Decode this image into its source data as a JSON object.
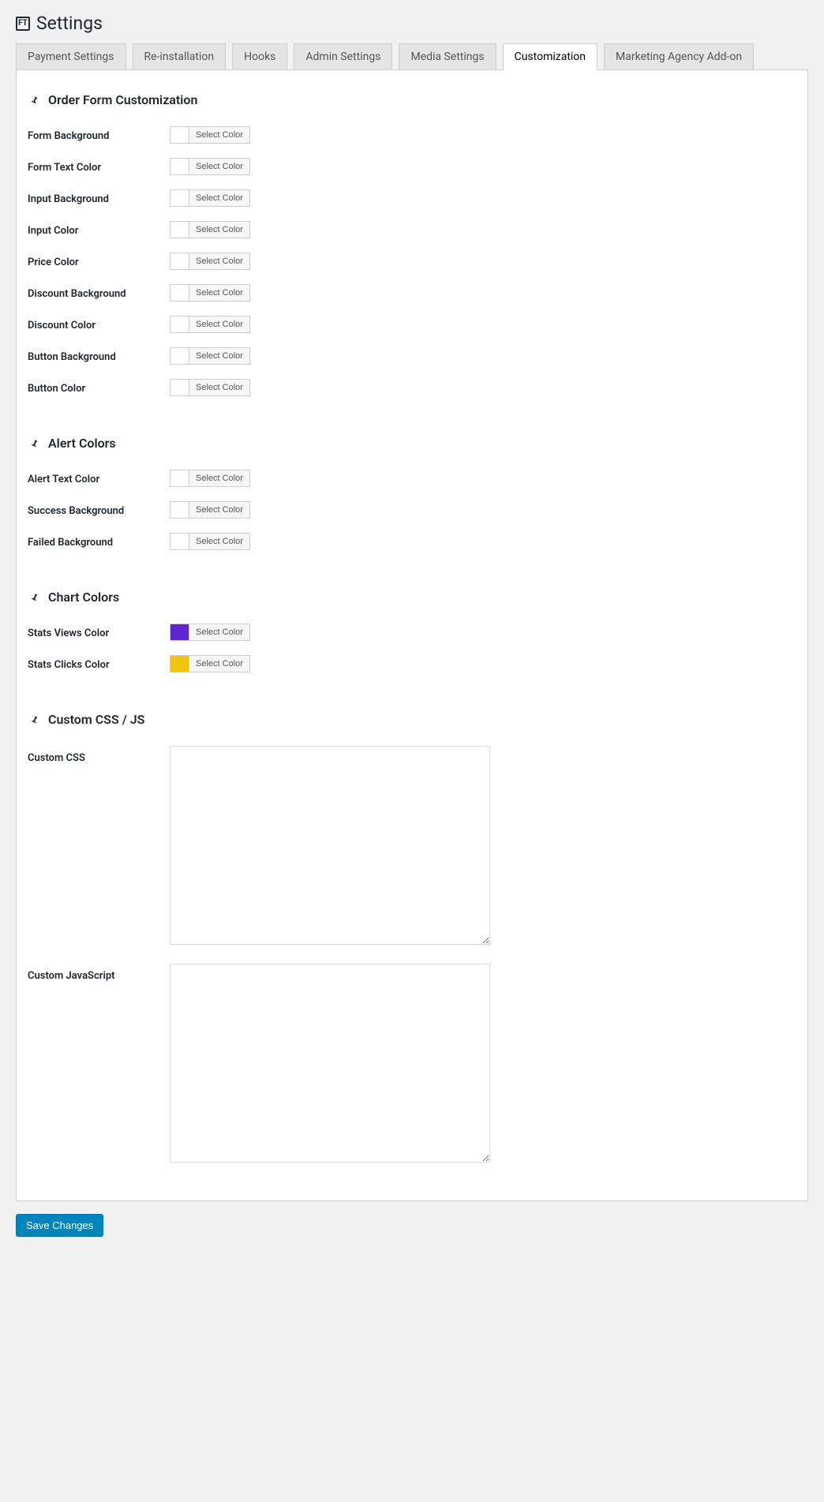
{
  "page": {
    "title": "Settings",
    "appIconText": "FT"
  },
  "tabs": [
    {
      "id": "payment",
      "label": "Payment Settings",
      "active": false
    },
    {
      "id": "reinstall",
      "label": "Re-installation",
      "active": false
    },
    {
      "id": "hooks",
      "label": "Hooks",
      "active": false
    },
    {
      "id": "admin",
      "label": "Admin Settings",
      "active": false
    },
    {
      "id": "media",
      "label": "Media Settings",
      "active": false
    },
    {
      "id": "custom",
      "label": "Customization",
      "active": true
    },
    {
      "id": "agency",
      "label": "Marketing Agency Add-on",
      "active": false
    }
  ],
  "sections": {
    "orderForm": {
      "title": "Order Form Customization",
      "rows": [
        {
          "name": "form-background",
          "label": "Form Background",
          "selectLabel": "Select Color",
          "value": ""
        },
        {
          "name": "form-text-color",
          "label": "Form Text Color",
          "selectLabel": "Select Color",
          "value": ""
        },
        {
          "name": "input-background",
          "label": "Input Background",
          "selectLabel": "Select Color",
          "value": ""
        },
        {
          "name": "input-color",
          "label": "Input Color",
          "selectLabel": "Select Color",
          "value": ""
        },
        {
          "name": "price-color",
          "label": "Price Color",
          "selectLabel": "Select Color",
          "value": ""
        },
        {
          "name": "discount-background",
          "label": "Discount Background",
          "selectLabel": "Select Color",
          "value": ""
        },
        {
          "name": "discount-color",
          "label": "Discount Color",
          "selectLabel": "Select Color",
          "value": ""
        },
        {
          "name": "button-background",
          "label": "Button Background",
          "selectLabel": "Select Color",
          "value": ""
        },
        {
          "name": "button-color",
          "label": "Button Color",
          "selectLabel": "Select Color",
          "value": ""
        }
      ]
    },
    "alertColors": {
      "title": "Alert Colors",
      "rows": [
        {
          "name": "alert-text-color",
          "label": "Alert Text Color",
          "selectLabel": "Select Color",
          "value": ""
        },
        {
          "name": "success-background",
          "label": "Success Background",
          "selectLabel": "Select Color",
          "value": ""
        },
        {
          "name": "failed-background",
          "label": "Failed Background",
          "selectLabel": "Select Color",
          "value": ""
        }
      ]
    },
    "chartColors": {
      "title": "Chart Colors",
      "rows": [
        {
          "name": "stats-views-color",
          "label": "Stats Views Color",
          "selectLabel": "Select Color",
          "value": "#5f27cd"
        },
        {
          "name": "stats-clicks-color",
          "label": "Stats Clicks Color",
          "selectLabel": "Select Color",
          "value": "#f1c40f"
        }
      ]
    },
    "customCode": {
      "title": "Custom CSS / JS",
      "css": {
        "label": "Custom CSS",
        "value": ""
      },
      "js": {
        "label": "Custom JavaScript",
        "value": ""
      }
    }
  },
  "footer": {
    "saveLabel": "Save Changes"
  }
}
